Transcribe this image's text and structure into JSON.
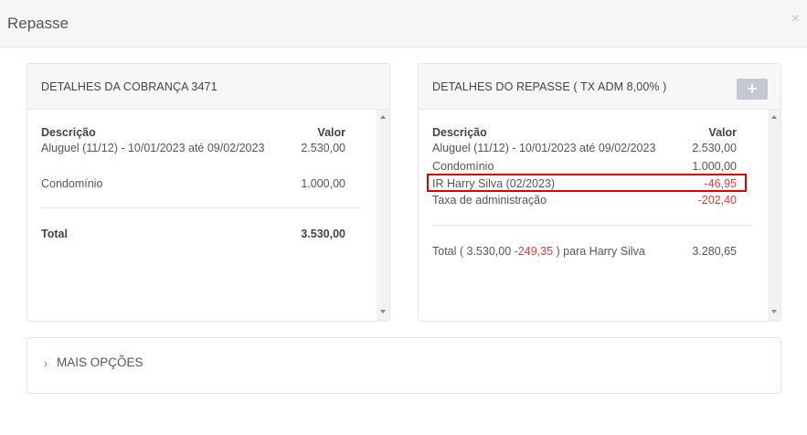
{
  "modal": {
    "title": "Repasse",
    "close_icon": "×"
  },
  "left_panel": {
    "title": "DETALHES DA COBRANÇA 3471",
    "col_desc": "Descrição",
    "col_valor": "Valor",
    "rows": [
      {
        "desc": "Aluguel (11/12) - 10/01/2023 até 09/02/2023",
        "valor": "2.530,00"
      },
      {
        "desc": "Condomínio",
        "valor": "1.000,00"
      }
    ],
    "total_label": "Total",
    "total_value": "3.530,00"
  },
  "right_panel": {
    "title": "DETALHES DO REPASSE ( TX ADM 8,00% )",
    "add_icon": "+",
    "col_desc": "Descrição",
    "col_valor": "Valor",
    "rows": [
      {
        "desc": "Aluguel (11/12) - 10/01/2023 até 09/02/2023",
        "valor": "2.530,00"
      },
      {
        "desc": "Condomínio",
        "valor": "1.000,00"
      },
      {
        "desc": "IR Harry Silva (02/2023)",
        "valor": "-46,95"
      },
      {
        "desc": "Taxa de administração",
        "valor": "-202,40"
      }
    ],
    "total_prefix": "Total ( 3.530,00 ",
    "total_discount": "-249,35",
    "total_suffix": " ) para Harry Silva",
    "total_value": "3.280,65"
  },
  "mais_opcoes": {
    "label": "MAIS OPÇÕES",
    "chevron": "›"
  },
  "colors": {
    "negative": "#e53935",
    "highlight": "#e00000"
  }
}
